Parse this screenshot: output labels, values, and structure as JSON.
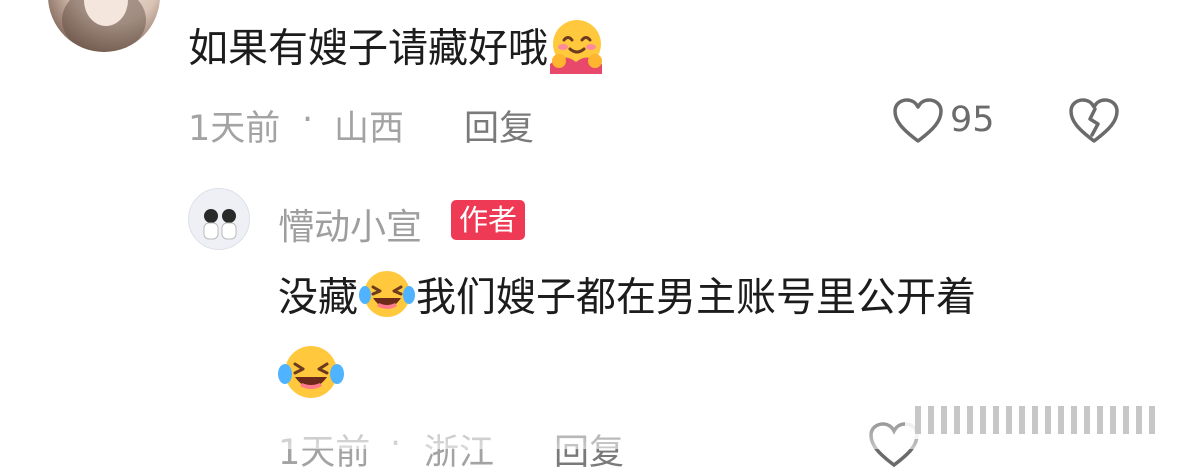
{
  "comment": {
    "text": "如果有嫂子请藏好哦",
    "emoji": "smiling-face-with-hands-emoji",
    "time": "1天前",
    "separator": "·",
    "location": "山西",
    "reply_label": "回复",
    "like_count": "95"
  },
  "reply": {
    "username": "懵动小宣",
    "badge": "作者",
    "text_part1": "没藏",
    "text_part2": "我们嫂子都在男主账号里公开着",
    "emoji": "laughing-crying-emoji",
    "time": "1天前",
    "separator": "·",
    "location": "浙江",
    "reply_label": "回复"
  },
  "colors": {
    "badge": "#ee3a55",
    "meta": "#a3a3a3"
  }
}
